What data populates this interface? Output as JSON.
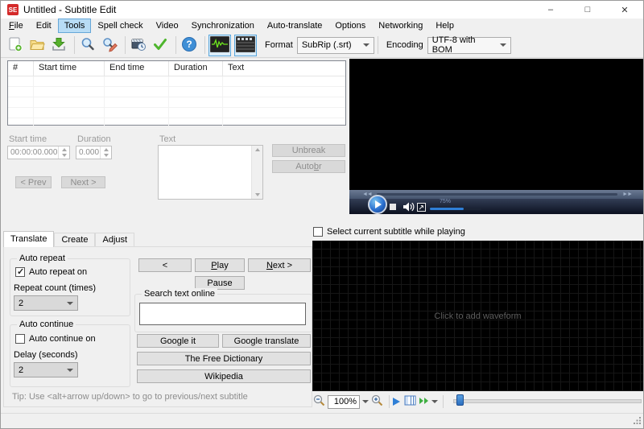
{
  "window": {
    "title": "Untitled - Subtitle Edit",
    "icon_text": "SE",
    "controls": {
      "minimize": "–",
      "maximize": "□",
      "close": "✕"
    }
  },
  "colors": {
    "menu_highlight": "#b8dcf5",
    "toggle_border": "#58a6dc",
    "app_icon_red": "#d42a2a",
    "waveform_green": "#6fe61e",
    "accent_blue": "#2f7fd6",
    "disabled_text": "#8d8d8d"
  },
  "menu": {
    "file": {
      "key": "F",
      "post": "ile"
    },
    "active": "Tools",
    "items": [
      "Edit",
      "Tools",
      "Spell check",
      "Video",
      "Synchronization",
      "Auto-translate",
      "Options",
      "Networking",
      "Help"
    ]
  },
  "toolbar": {
    "format_label": "Format",
    "format_value": "SubRip (.srt)",
    "encoding_label": "Encoding",
    "encoding_value": "UTF-8 with BOM"
  },
  "subtitle_list": {
    "columns": [
      "#",
      "Start time",
      "End time",
      "Duration",
      "Text"
    ]
  },
  "edit_panel": {
    "start_time_label": "Start time",
    "start_time_value": "00:00:00.000",
    "duration_label": "Duration",
    "duration_value": "0.000",
    "text_label": "Text",
    "unbreak_label": "Unbreak",
    "auto_br": {
      "pre": "Auto ",
      "key": "b",
      "post": "r"
    },
    "prev_label": "< Prev",
    "next_label": "Next >"
  },
  "video": {
    "rewind": "◄◄",
    "forward": "►►",
    "volume_percent": "75%"
  },
  "tabs": {
    "translate": "Translate",
    "create": "Create",
    "adjust": "Adjust",
    "active": "Translate"
  },
  "translate_panel": {
    "auto_repeat_title": "Auto repeat",
    "auto_repeat_checkbox": "Auto repeat on",
    "repeat_count_label": "Repeat count (times)",
    "repeat_count_value": "2",
    "auto_continue_title": "Auto continue",
    "auto_continue_checkbox": "Auto continue on",
    "delay_label": "Delay (seconds)",
    "delay_value": "2",
    "back_label": "<",
    "play": {
      "key": "P",
      "post": "lay"
    },
    "next": {
      "key": "N",
      "post": "ext >"
    },
    "pause_label": "Pause",
    "search_title": "Search text online",
    "search_value": "",
    "google_it": "Google it",
    "google_translate": "Google translate",
    "free_dictionary": "The Free Dictionary",
    "wikipedia": "Wikipedia",
    "tip": "Tip: Use <alt+arrow up/down> to go to previous/next subtitle"
  },
  "waveform": {
    "select_checkbox": "Select current subtitle while playing",
    "placeholder": "Click to add waveform",
    "zoom_value": "100%"
  }
}
